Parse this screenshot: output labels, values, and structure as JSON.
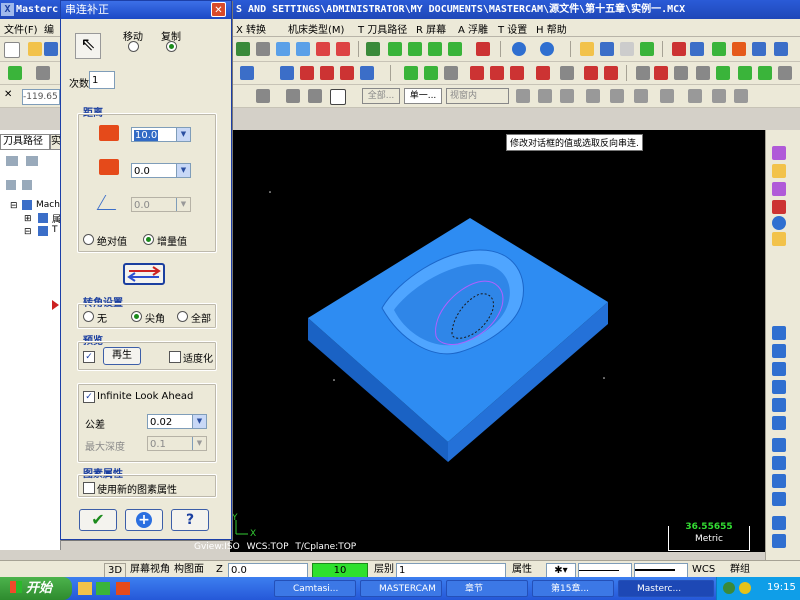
{
  "window": {
    "title_prefix": "Masterc",
    "title_path": "S AND SETTINGS\\ADMINISTRATOR\\MY DOCUMENTS\\MASTERCAM\\源文件\\第十五章\\实例一.MCX"
  },
  "menubar": {
    "items": [
      "文件(F)",
      "编",
      "X 转换",
      "机床类型(M)",
      "T 刀具路径",
      "R 屏幕",
      "A 浮雕",
      "T 设置",
      "H 帮助"
    ]
  },
  "toolbar3": {
    "coord_x": "-119.65",
    "view_select": "全部...",
    "level_select": "单一...",
    "view_combo": "视窗内"
  },
  "leftpanel": {
    "tab_toolpath": "刀具路径",
    "tab_other": "实",
    "tree_machine": "Mach",
    "tree_file": "属",
    "tree_tool": "T"
  },
  "dialog": {
    "title": "串连补正",
    "move_label": "移动",
    "copy_label": "复制",
    "count_label": "次数",
    "count_value": "1",
    "distance_group": "距离",
    "dist1_value": "10.0",
    "dist2_value": "0.0",
    "angle_value": "0.0",
    "absolute_label": "绝对值",
    "incremental_label": "增量值",
    "corner_group": "转角设置",
    "corner_none": "无",
    "corner_sharp": "尖角",
    "corner_all": "全部",
    "preview_group": "预览",
    "regen_button": "再生",
    "fit_label": "适度化",
    "infinite_label": "Infinite Look Ahead",
    "tolerance_label": "公差",
    "tolerance_value": "0.02",
    "max_depth_label": "最大深度",
    "max_depth_value": "0.1",
    "attr_group": "图素属性",
    "use_new_attr": "使用新的图素属性",
    "help_button": "?"
  },
  "viewport": {
    "tooltip": "修改对话框的值或选取反向串连.",
    "gview": "Gview:ISO",
    "wcs": "WCS:TOP",
    "tcplane": "T/Cplane:TOP",
    "scale_value": "36.55655",
    "scale_unit": "Metric",
    "axis_y": "Y",
    "axis_x": "X"
  },
  "statusbar": {
    "mode_3d": "3D",
    "screen_view": "屏幕视角",
    "plane": "构图面",
    "z_label": "Z",
    "z_value": "0.0",
    "color_value": "10",
    "level_label": "层别",
    "level_value": "1",
    "attr_label": "属性",
    "wcs_label": "WCS",
    "group_label": "群组"
  },
  "taskbar": {
    "start_label": "开始",
    "tasks": [
      "Camtasi...",
      "MASTERCAM",
      "章节",
      "第15章...",
      "Masterc..."
    ],
    "clock": "19:15"
  },
  "colors": {
    "part_top": "#2e8cf2",
    "part_side": "#1b66c9",
    "viewport_bg": "#000000",
    "scale_text": "#33dd33",
    "toolpath": "#b060ff"
  }
}
